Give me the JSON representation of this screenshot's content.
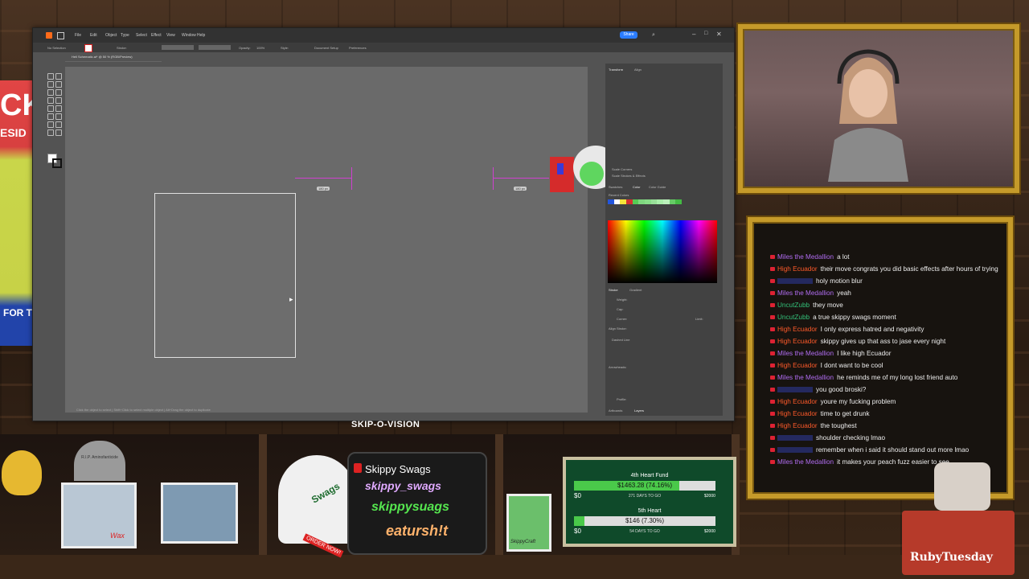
{
  "illustrator": {
    "menus": [
      "File",
      "Edit",
      "Object",
      "Type",
      "Select",
      "Effect",
      "View",
      "Window",
      "Help"
    ],
    "share_label": "Share",
    "control": {
      "selection": "No Selection",
      "stroke_label": "Stroke:",
      "opacity_label": "Opacity:",
      "opacity_value": "100%",
      "style_label": "Style:",
      "doc_setup": "Document Setup",
      "preferences": "Preferences"
    },
    "doc_tab": "Heli Schematic.ai* @ 50 % (RGB/Preview)",
    "measure_left": "180 px",
    "measure_right": "180 px",
    "panel": {
      "tab_transform": "Transform",
      "tab_align": "Align",
      "scale_corners": "Scale Corners",
      "scale_strokes": "Scale Strokes & Effects",
      "tab_swatches": "Swatches",
      "tab_color": "Color",
      "tab_color_guide": "Color Guide",
      "recent_colors": "Recent Colors",
      "tab_stroke": "Stroke",
      "tab_gradient": "Gradient",
      "weight": "Weight:",
      "cap": "Cap:",
      "corner": "Corner:",
      "limit": "Limit:",
      "align_stroke": "Align Stroke:",
      "dashed_line": "Dashed Line",
      "arrowheads": "Arrowheads:",
      "profile": "Profile:",
      "tab_artboards": "Artboards",
      "tab_layers": "Layers"
    },
    "swatch_colors": [
      "#2255dd",
      "#ffffff",
      "#f5e53a",
      "#d43030",
      "#55cc55",
      "#7fd67f",
      "#88dd88",
      "#99e099",
      "#aaeeaa",
      "#bbf0bb",
      "#66cc66",
      "#44bb44"
    ],
    "status": "Click the object to select | Shift+Click to select multiple object | Alt+Drag the object to duplicate",
    "zoom": "50%"
  },
  "overlay_title": "SKIP-O-VISION",
  "chat": {
    "messages": [
      {
        "user": "Miles the Medallion",
        "color": "#b06cf0",
        "text": "a lot"
      },
      {
        "user": "High Ecuador",
        "color": "#ff5a2a",
        "text": "their move congrats you did basic effects after hours of trying",
        "wrap": true
      },
      {
        "user": "",
        "color": "#3a4cd8",
        "text": "holy motion blur"
      },
      {
        "user": "Miles the Medallion",
        "color": "#b06cf0",
        "text": "yeah"
      },
      {
        "user": "UncutZubb",
        "color": "#33c27a",
        "text": "they move"
      },
      {
        "user": "UncutZubb",
        "color": "#33c27a",
        "text": "a true skippy swags moment"
      },
      {
        "user": "High Ecuador",
        "color": "#ff5a2a",
        "text": "I only express hatred and negativity"
      },
      {
        "user": "High Ecuador",
        "color": "#ff5a2a",
        "text": "skippy gives up that ass to jase every night"
      },
      {
        "user": "Miles the Medallion",
        "color": "#b06cf0",
        "text": "I like high Ecuador"
      },
      {
        "user": "High Ecuador",
        "color": "#ff5a2a",
        "text": "I dont want to be cool"
      },
      {
        "user": "Miles the Medallion",
        "color": "#b06cf0",
        "text": "he reminds me of my long lost friend auto"
      },
      {
        "user": "",
        "color": "#3a4cd8",
        "text": "you good broski?"
      },
      {
        "user": "High Ecuador",
        "color": "#ff5a2a",
        "text": "youre my fucking problem"
      },
      {
        "user": "High Ecuador",
        "color": "#ff5a2a",
        "text": "time to get drunk"
      },
      {
        "user": "High Ecuador",
        "color": "#ff5a2a",
        "text": "the toughest"
      },
      {
        "user": "",
        "color": "#3a4cd8",
        "text": "shoulder checking lmao"
      },
      {
        "user": "",
        "color": "#3a4cd8",
        "text": "remember when i said it should stand out more lmao"
      },
      {
        "user": "Miles the Medallion",
        "color": "#b06cf0",
        "text": "it makes your peach fuzz easier to see"
      }
    ]
  },
  "shelf": {
    "grave_text": "R.I.P. Aminofanticide",
    "photo_caption": "Wax",
    "swags_brand": "Skippy Swags",
    "swags_line1": "skippy_swags",
    "swags_line2": "skippysuags",
    "swags_line3": "eatursh!t",
    "order_now": "ORDER NOW!",
    "hat_text": "Swags",
    "minecraft_caption": "SkippyCraft",
    "poster_t1": "CK",
    "poster_t2": "ESID",
    "poster_t3": "FOR T"
  },
  "funds": [
    {
      "title": "4th Heart Fund",
      "amount": "$1463.28 (74.16%)",
      "percent": 74.16,
      "min": "$0",
      "max": "$2000",
      "days": "271 DAYS TO GO"
    },
    {
      "title": "5th Heart",
      "amount": "$146 (7.30%)",
      "percent": 7.3,
      "min": "$0",
      "max": "$2000",
      "days": "54 DAYS TO GO"
    }
  ],
  "ruby_label": "RubyTuesday"
}
